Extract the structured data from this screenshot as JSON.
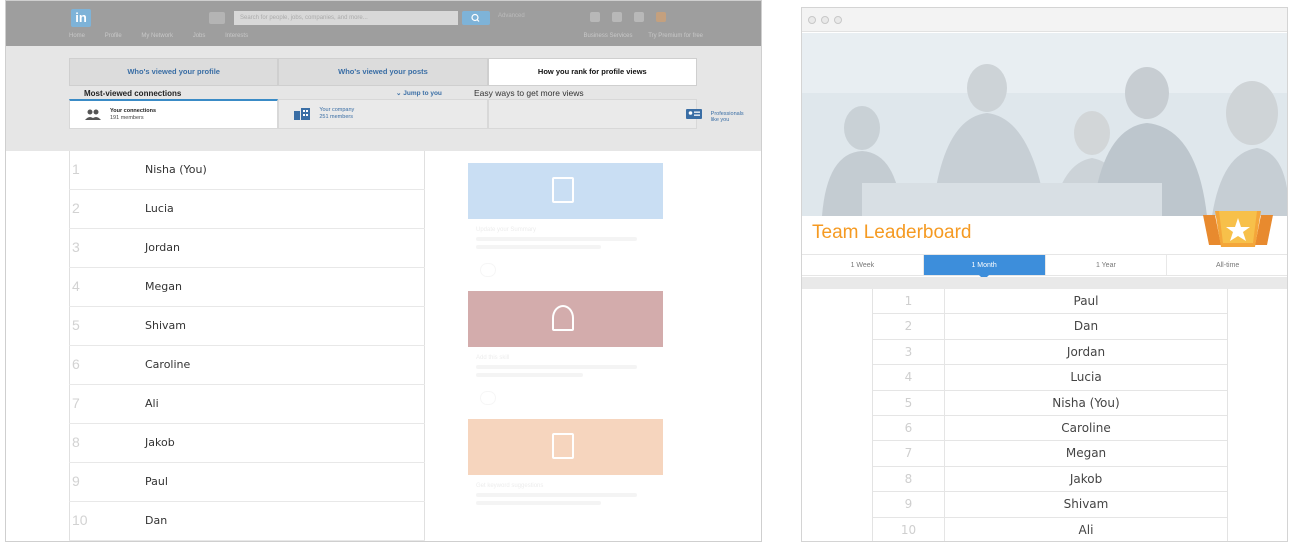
{
  "left_panel": {
    "header": {
      "logo": "in",
      "search_placeholder": "Search for people, jobs, companies, and more...",
      "advanced_label": "Advanced",
      "nav_items": [
        "Home",
        "Profile",
        "My Network",
        "Jobs",
        "Interests"
      ],
      "nav_right": [
        "Business Services",
        "Try Premium for free"
      ]
    },
    "tabs": [
      {
        "label": "Who's viewed your profile",
        "active": false
      },
      {
        "label": "Who's viewed your posts",
        "active": false
      },
      {
        "label": "How you rank for profile views",
        "active": true
      }
    ],
    "subtabs": [
      {
        "label": "Your connections",
        "sub": "191 members",
        "icon": "people-icon"
      },
      {
        "label": "Your company",
        "sub": "251 members",
        "icon": "building-icon"
      },
      {
        "label": "Professionals like you",
        "sub": "",
        "icon": "card-icon"
      }
    ],
    "most_viewed_label": "Most-viewed connections",
    "jump_label": "Jump to you",
    "easy_ways_label": "Easy ways to get more views",
    "rankings": [
      {
        "rank": "1",
        "name": "Nisha (You)"
      },
      {
        "rank": "2",
        "name": "Lucia"
      },
      {
        "rank": "3",
        "name": "Jordan"
      },
      {
        "rank": "4",
        "name": "Megan"
      },
      {
        "rank": "5",
        "name": "Shivam"
      },
      {
        "rank": "6",
        "name": "Caroline"
      },
      {
        "rank": "7",
        "name": "Ali"
      },
      {
        "rank": "8",
        "name": "Jakob"
      },
      {
        "rank": "9",
        "name": "Paul"
      },
      {
        "rank": "10",
        "name": "Dan"
      }
    ],
    "cards": [
      {
        "title": "Update your Summary",
        "color": "#9ec4ea"
      },
      {
        "title": "Add this skill",
        "color": "#b06a6a"
      },
      {
        "title": "Get keyword suggestions",
        "color": "#f0b38a"
      }
    ]
  },
  "right_panel": {
    "title": "Team Leaderboard",
    "title_color": "#f59a22",
    "accent_color": "#3d8edb",
    "periods": [
      {
        "label": "1 Week",
        "active": false
      },
      {
        "label": "1 Month",
        "active": true
      },
      {
        "label": "1 Year",
        "active": false
      },
      {
        "label": "All-time",
        "active": false
      }
    ],
    "rankings": [
      {
        "rank": "1",
        "name": "Paul"
      },
      {
        "rank": "2",
        "name": "Dan"
      },
      {
        "rank": "3",
        "name": "Jordan"
      },
      {
        "rank": "4",
        "name": "Lucia"
      },
      {
        "rank": "5",
        "name": "Nisha (You)"
      },
      {
        "rank": "6",
        "name": "Caroline"
      },
      {
        "rank": "7",
        "name": "Megan"
      },
      {
        "rank": "8",
        "name": "Jakob"
      },
      {
        "rank": "9",
        "name": "Shivam"
      },
      {
        "rank": "10",
        "name": "Ali"
      }
    ]
  }
}
